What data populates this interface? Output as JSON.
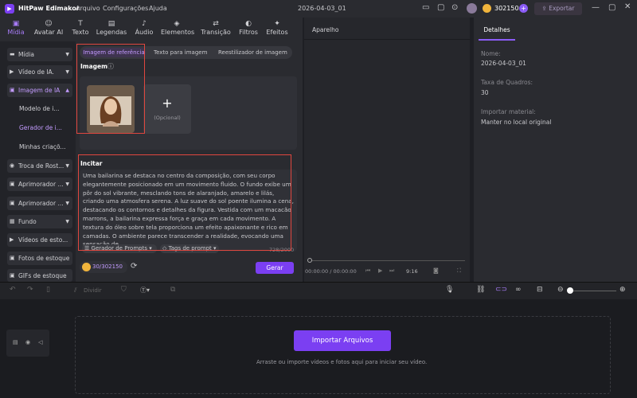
{
  "app": {
    "title": "HitPaw Edimakor",
    "menu": [
      "Arquivo",
      "Configurações",
      "Ajuda"
    ],
    "project_name": "2026-04-03_01",
    "credits": "302150",
    "export_label": "Exportar"
  },
  "toolbar": [
    {
      "label": "Mídia",
      "icon": "media-icon"
    },
    {
      "label": "Avatar AI",
      "icon": "avatar-icon"
    },
    {
      "label": "Texto",
      "icon": "text-icon"
    },
    {
      "label": "Legendas",
      "icon": "captions-icon"
    },
    {
      "label": "Áudio",
      "icon": "audio-icon"
    },
    {
      "label": "Elementos",
      "icon": "elements-icon"
    },
    {
      "label": "Transição",
      "icon": "transition-icon"
    },
    {
      "label": "Filtros",
      "icon": "filters-icon"
    },
    {
      "label": "Efeitos",
      "icon": "effects-icon"
    }
  ],
  "sidebar": {
    "items": [
      "Mídia",
      "Vídeo de IA.",
      "Imagem de IA",
      "Modelo de i...",
      "Gerador de i...",
      "Minhas criaçõ...",
      "Troca de Rost...",
      "Aprimorador ...",
      "Aprimorador ...",
      "Fundo",
      "Vídeos de esto...",
      "Fotos de estoque",
      "GIFs de estoque"
    ]
  },
  "panel": {
    "tabs": [
      "Imagem de referência",
      "Texto para imagem",
      "Reestilizador de imagem"
    ],
    "image_section_label": "Imagem",
    "optional_label": "(Opcional)",
    "prompt_label": "Incitar",
    "prompt_text": "Uma bailarina se destaca no centro da composição, com seu corpo elegantemente posicionado em um movimento fluido. O fundo exibe um pôr do sol vibrante, mesclando tons de alaranjado, amarelo e lilás, criando uma atmosfera serena. A luz suave do sol poente ilumina a cena, destacando os contornos e detalhes da figura. Vestida com um macacão marrons, a bailarina expressa força e graça em cada movimento. A textura do óleo sobre tela proporciona um efeito apaixonante e rico em camadas. O ambiente parece transcender a realidade, evocando uma sensação de",
    "prompt_generator_label": "Gerador de Prompts",
    "prompt_tags_label": "Tags de prompt",
    "char_count": "728/2000",
    "credits_display": "30/302150",
    "generate_label": "Gerar"
  },
  "preview": {
    "title": "Aparelho",
    "time": "00:00:00 / 00:00:00",
    "aspect": "9:16"
  },
  "details": {
    "tab": "Detalhes",
    "name_label": "Nome:",
    "name_value": "2026-04-03_01",
    "fps_label": "Taxa de Quadros:",
    "fps_value": "30",
    "import_label": "Importar material:",
    "import_value": "Manter no local original"
  },
  "timeline_toolbar": {
    "split_label": "Dividir"
  },
  "dropzone": {
    "button_label": "Importar Arquivos",
    "hint": "Arraste ou importe vídeos e fotos aqui para iniciar seu vídeo."
  },
  "colors": {
    "accent": "#7b3ff2",
    "highlight": "#e0473f"
  }
}
